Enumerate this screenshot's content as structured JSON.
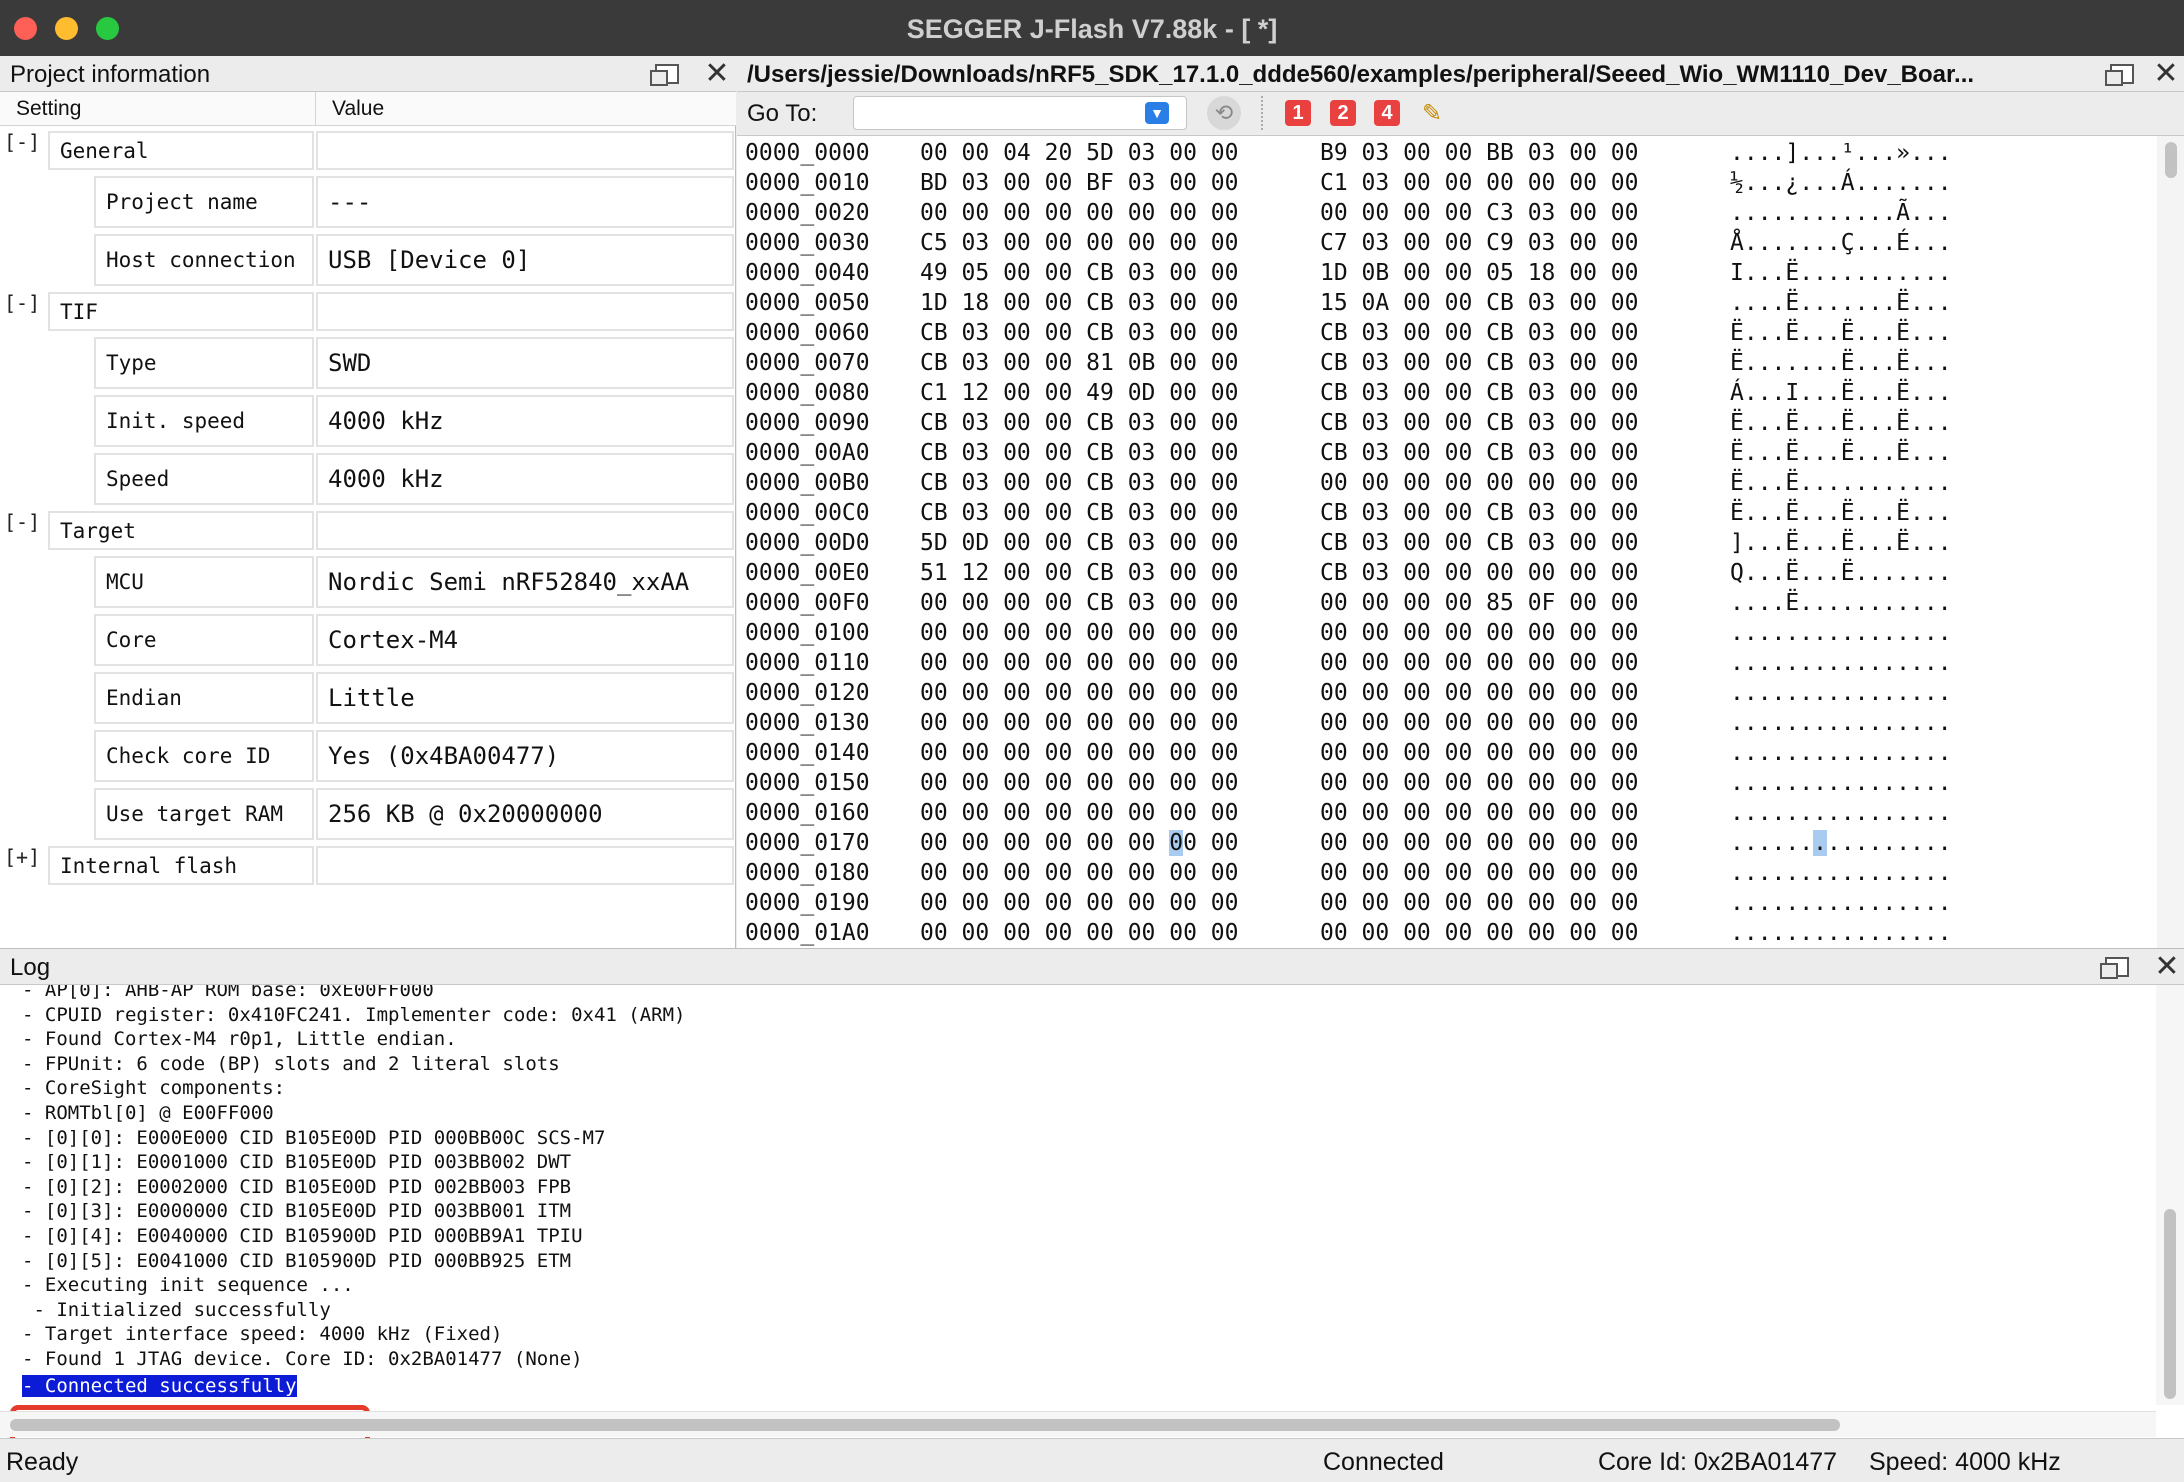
{
  "window": {
    "title": "SEGGER J-Flash V7.88k - [ *]"
  },
  "project_panel": {
    "title": "Project information",
    "col_setting": "Setting",
    "col_value": "Value",
    "groups": [
      {
        "toggle": "[-]",
        "name": "General",
        "items": [
          {
            "setting": "Project name",
            "value": "---"
          },
          {
            "setting": "Host connection",
            "value": "USB [Device 0]"
          }
        ]
      },
      {
        "toggle": "[-]",
        "name": "TIF",
        "items": [
          {
            "setting": "Type",
            "value": "SWD"
          },
          {
            "setting": "Init. speed",
            "value": "4000 kHz"
          },
          {
            "setting": "Speed",
            "value": "4000 kHz"
          }
        ]
      },
      {
        "toggle": "[-]",
        "name": "Target",
        "items": [
          {
            "setting": "MCU",
            "value": "Nordic Semi nRF52840_xxAA"
          },
          {
            "setting": "Core",
            "value": "Cortex-M4"
          },
          {
            "setting": "Endian",
            "value": "Little"
          },
          {
            "setting": "Check core ID",
            "value": "Yes (0x4BA00477)"
          },
          {
            "setting": "Use target RAM",
            "value": "256 KB @ 0x20000000"
          }
        ]
      },
      {
        "toggle": "[+]",
        "name": "Internal flash",
        "items": []
      }
    ]
  },
  "hex_panel": {
    "title": "/Users/jessie/Downloads/nRF5_SDK_17.1.0_ddde560/examples/peripheral/Seeed_Wio_WM1110_Dev_Boar...",
    "goto_label": "Go To:",
    "goto_value": "",
    "width_buttons": [
      "1",
      "2",
      "4"
    ],
    "rows": [
      {
        "addr": "0000_0000",
        "b1": "00 00 04 20 5D 03 00 00",
        "b2": "B9 03 00 00 BB 03 00 00",
        "ascii": "....]...¹...»..."
      },
      {
        "addr": "0000_0010",
        "b1": "BD 03 00 00 BF 03 00 00",
        "b2": "C1 03 00 00 00 00 00 00",
        "ascii": "½...¿...Á......."
      },
      {
        "addr": "0000_0020",
        "b1": "00 00 00 00 00 00 00 00",
        "b2": "00 00 00 00 C3 03 00 00",
        "ascii": "............Ã..."
      },
      {
        "addr": "0000_0030",
        "b1": "C5 03 00 00 00 00 00 00",
        "b2": "C7 03 00 00 C9 03 00 00",
        "ascii": "Å.......Ç...É..."
      },
      {
        "addr": "0000_0040",
        "b1": "49 05 00 00 CB 03 00 00",
        "b2": "1D 0B 00 00 05 18 00 00",
        "ascii": "I...Ë..........."
      },
      {
        "addr": "0000_0050",
        "b1": "1D 18 00 00 CB 03 00 00",
        "b2": "15 0A 00 00 CB 03 00 00",
        "ascii": "....Ë.......Ë..."
      },
      {
        "addr": "0000_0060",
        "b1": "CB 03 00 00 CB 03 00 00",
        "b2": "CB 03 00 00 CB 03 00 00",
        "ascii": "Ë...Ë...Ë...Ë..."
      },
      {
        "addr": "0000_0070",
        "b1": "CB 03 00 00 81 0B 00 00",
        "b2": "CB 03 00 00 CB 03 00 00",
        "ascii": "Ë.......Ë...Ë..."
      },
      {
        "addr": "0000_0080",
        "b1": "C1 12 00 00 49 0D 00 00",
        "b2": "CB 03 00 00 CB 03 00 00",
        "ascii": "Á...I...Ë...Ë..."
      },
      {
        "addr": "0000_0090",
        "b1": "CB 03 00 00 CB 03 00 00",
        "b2": "CB 03 00 00 CB 03 00 00",
        "ascii": "Ë...Ë...Ë...Ë..."
      },
      {
        "addr": "0000_00A0",
        "b1": "CB 03 00 00 CB 03 00 00",
        "b2": "CB 03 00 00 CB 03 00 00",
        "ascii": "Ë...Ë...Ë...Ë..."
      },
      {
        "addr": "0000_00B0",
        "b1": "CB 03 00 00 CB 03 00 00",
        "b2": "00 00 00 00 00 00 00 00",
        "ascii": "Ë...Ë..........."
      },
      {
        "addr": "0000_00C0",
        "b1": "CB 03 00 00 CB 03 00 00",
        "b2": "CB 03 00 00 CB 03 00 00",
        "ascii": "Ë...Ë...Ë...Ë..."
      },
      {
        "addr": "0000_00D0",
        "b1": "5D 0D 00 00 CB 03 00 00",
        "b2": "CB 03 00 00 CB 03 00 00",
        "ascii": "]...Ë...Ë...Ë..."
      },
      {
        "addr": "0000_00E0",
        "b1": "51 12 00 00 CB 03 00 00",
        "b2": "CB 03 00 00 00 00 00 00",
        "ascii": "Q...Ë...Ë......."
      },
      {
        "addr": "0000_00F0",
        "b1": "00 00 00 00 CB 03 00 00",
        "b2": "00 00 00 00 85 0F 00 00",
        "ascii": "....Ë..........."
      },
      {
        "addr": "0000_0100",
        "b1": "00 00 00 00 00 00 00 00",
        "b2": "00 00 00 00 00 00 00 00",
        "ascii": "................"
      },
      {
        "addr": "0000_0110",
        "b1": "00 00 00 00 00 00 00 00",
        "b2": "00 00 00 00 00 00 00 00",
        "ascii": "................"
      },
      {
        "addr": "0000_0120",
        "b1": "00 00 00 00 00 00 00 00",
        "b2": "00 00 00 00 00 00 00 00",
        "ascii": "................"
      },
      {
        "addr": "0000_0130",
        "b1": "00 00 00 00 00 00 00 00",
        "b2": "00 00 00 00 00 00 00 00",
        "ascii": "................"
      },
      {
        "addr": "0000_0140",
        "b1": "00 00 00 00 00 00 00 00",
        "b2": "00 00 00 00 00 00 00 00",
        "ascii": "................"
      },
      {
        "addr": "0000_0150",
        "b1": "00 00 00 00 00 00 00 00",
        "b2": "00 00 00 00 00 00 00 00",
        "ascii": "................"
      },
      {
        "addr": "0000_0160",
        "b1": "00 00 00 00 00 00 00 00",
        "b2": "00 00 00 00 00 00 00 00",
        "ascii": "................"
      },
      {
        "addr": "0000_0170",
        "b1": "00 00 00 00 00 00 00 00",
        "b2": "00 00 00 00 00 00 00 00",
        "ascii": "................",
        "selected_byte": 6
      },
      {
        "addr": "0000_0180",
        "b1": "00 00 00 00 00 00 00 00",
        "b2": "00 00 00 00 00 00 00 00",
        "ascii": "................"
      },
      {
        "addr": "0000_0190",
        "b1": "00 00 00 00 00 00 00 00",
        "b2": "00 00 00 00 00 00 00 00",
        "ascii": "................"
      },
      {
        "addr": "0000_01A0",
        "b1": "00 00 00 00 00 00 00 00",
        "b2": "00 00 00 00 00 00 00 00",
        "ascii": "................"
      }
    ]
  },
  "log_panel": {
    "title": "Log",
    "lines": [
      "- AP[0]: AHB-AP ROM base: 0xE00FF000",
      "- CPUID register: 0x410FC241. Implementer code: 0x41 (ARM)",
      "- Found Cortex-M4 r0p1, Little endian.",
      "- FPUnit: 6 code (BP) slots and 2 literal slots",
      "- CoreSight components:",
      "- ROMTbl[0] @ E00FF000",
      "- [0][0]: E000E000 CID B105E00D PID 000BB00C SCS-M7",
      "- [0][1]: E0001000 CID B105E00D PID 003BB002 DWT",
      "- [0][2]: E0002000 CID B105E00D PID 002BB003 FPB",
      "- [0][3]: E0000000 CID B105E00D PID 003BB001 ITM",
      "- [0][4]: E0040000 CID B105900D PID 000BB9A1 TPIU",
      "- [0][5]: E0041000 CID B105900D PID 000BB925 ETM",
      "- Executing init sequence ...",
      " - Initialized successfully",
      "- Target interface speed: 4000 kHz (Fixed)",
      "- Found 1 JTAG device. Core ID: 0x2BA01477 (None)"
    ],
    "highlighted_line": "- Connected successfully"
  },
  "status_bar": {
    "left": "Ready",
    "connection": "Connected",
    "core_id": "Core Id: 0x2BA01477",
    "speed": "Speed: 4000 kHz"
  },
  "colors": {
    "titlebar": "#3a3a3a",
    "selection": "#0b1bd6",
    "highlight_box": "#e53b2a",
    "width_button": "#e94040"
  }
}
